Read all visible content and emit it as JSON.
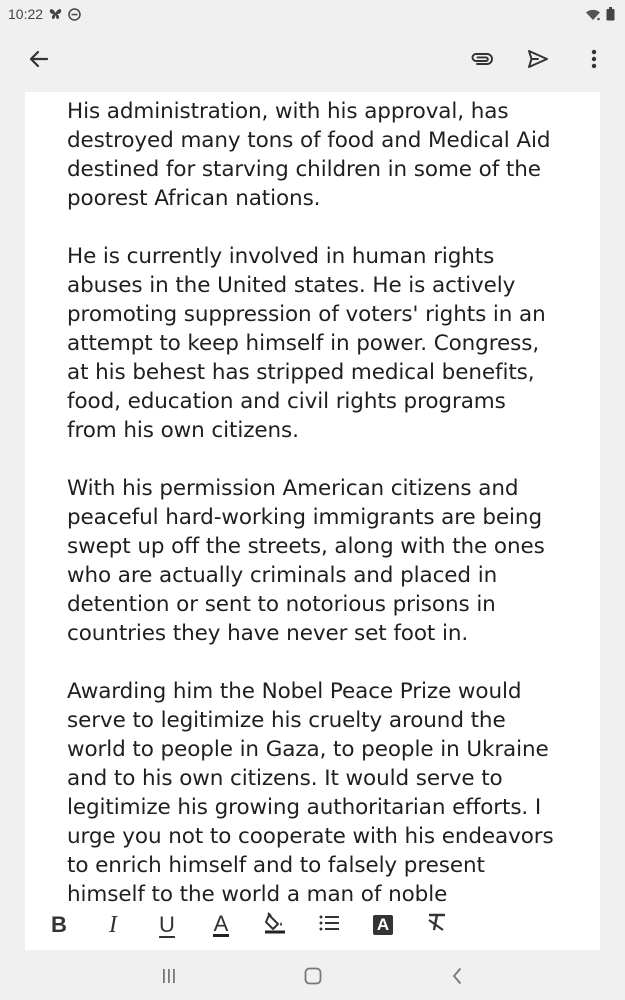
{
  "status_bar": {
    "time": "10:22",
    "icons": [
      "butterfly-icon",
      "do-not-disturb-icon",
      "wifi-icon",
      "battery-icon"
    ]
  },
  "app_bar": {
    "icons": [
      "back-arrow-icon",
      "attach-icon",
      "send-icon",
      "more-vert-icon"
    ]
  },
  "editor": {
    "paragraphs": [
      "His administration, with his approval, has\ndestroyed many tons of food and Medical Aid\ndestined for starving children in some of the\npoorest African nations.",
      "He is currently involved in human rights\nabuses in the United states. He is actively\npromoting suppression of voters' rights in an\nattempt to keep himself in power. Congress,\nat his behest has stripped medical benefits,\nfood, education and civil rights programs\nfrom his own citizens.",
      "With his permission American citizens and\npeaceful hard-working immigrants are being\nswept up off the streets, along with the ones\nwho are actually criminals and placed in\ndetention or sent to notorious prisons in\ncountries they have never set foot in.",
      "Awarding him the Nobel Peace Prize would\nserve to legitimize his cruelty around the\nworld to people in Gaza, to people in Ukraine\nand to his own citizens. It would serve to\nlegitimize his growing authoritarian efforts. I\nurge you not to cooperate with his endeavors\nto enrich himself and to falsely present\nhimself to the world a man of noble"
    ]
  },
  "format_toolbar": {
    "bold_label": "B",
    "italic_label": "I",
    "underline_label": "U",
    "text_color_label": "A",
    "highlight_label": "",
    "list_label": "",
    "text_bg_label": "A",
    "clear_format_label": ""
  },
  "nav_bar": {
    "icons": [
      "recents-icon",
      "home-icon",
      "back-icon"
    ]
  },
  "colors": {
    "background": "#f0f0f0",
    "surface": "#ffffff",
    "icon": "#333333"
  }
}
